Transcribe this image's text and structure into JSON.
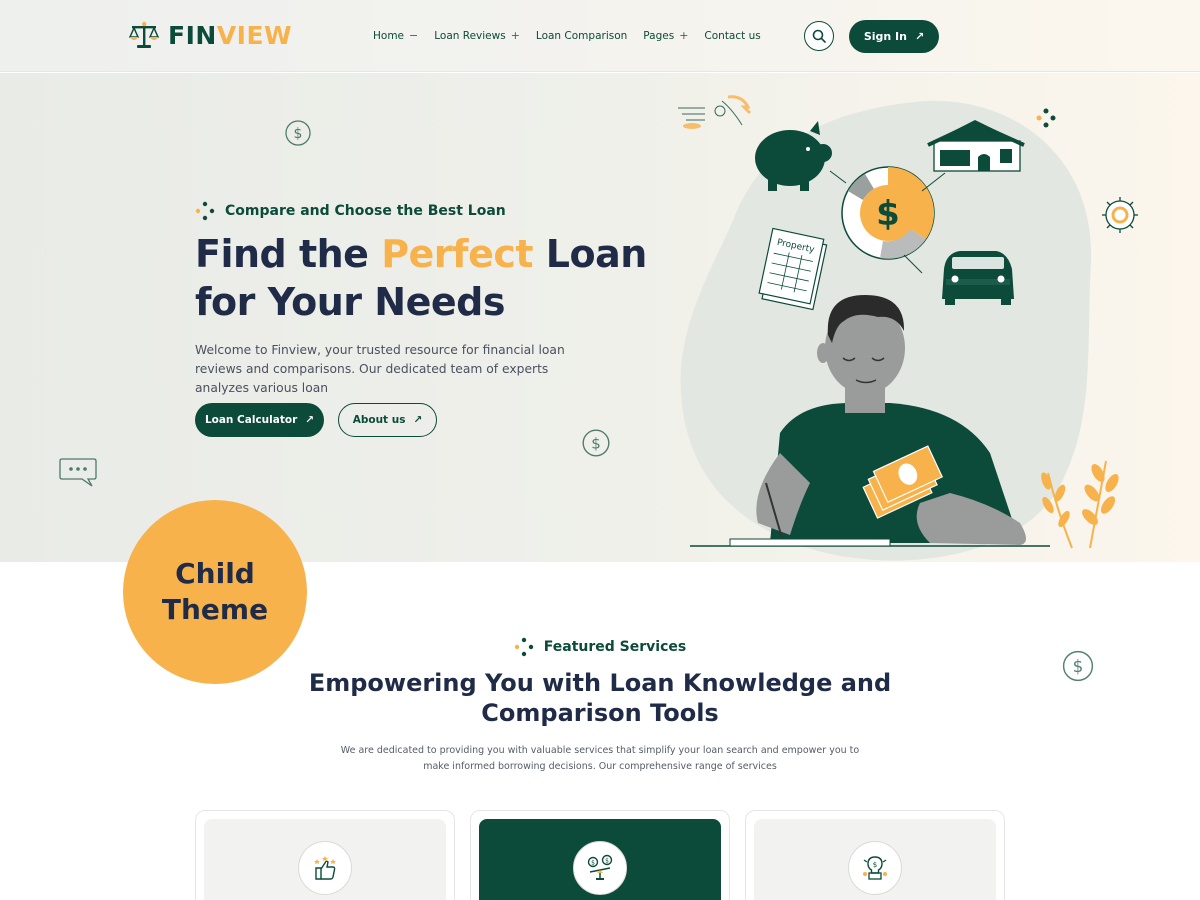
{
  "header": {
    "logo_part1": "FIN",
    "logo_part2": "VIEW",
    "nav": [
      {
        "label": "Home",
        "sign": "−"
      },
      {
        "label": "Loan Reviews",
        "sign": "+"
      },
      {
        "label": "Loan Comparison",
        "sign": ""
      },
      {
        "label": "Pages",
        "sign": "+"
      },
      {
        "label": "Contact us",
        "sign": ""
      }
    ],
    "signin_label": "Sign In",
    "arrow": "↗"
  },
  "hero": {
    "eyebrow": "Compare and Choose the Best Loan",
    "title_part1": "Find the ",
    "title_accent": "Perfect",
    "title_part2": " Loan",
    "title_line2": "for Your Needs",
    "description": "Welcome to Finview, your trusted resource for financial loan reviews and comparisons. Our dedicated team of experts analyzes various loan",
    "primary_button": "Loan Calculator",
    "secondary_button": "About us",
    "illustration_label": "Property",
    "dollar_sign": "$"
  },
  "badge": {
    "line1": "Child",
    "line2": "Theme"
  },
  "services": {
    "eyebrow": "Featured Services",
    "title_line1": "Empowering You with Loan Knowledge and",
    "title_line2": "Comparison Tools",
    "description": "We are dedicated to providing you with valuable services that simplify your loan search and empower you to make informed borrowing decisions. Our comprehensive range of services",
    "cards": [
      {
        "icon": "thumbs-up-stars-icon"
      },
      {
        "icon": "balance-scale-icon"
      },
      {
        "icon": "idea-bulb-icon"
      }
    ]
  },
  "colors": {
    "primary": "#0c4a3a",
    "accent": "#f7b24b",
    "heading": "#1f2b47"
  }
}
